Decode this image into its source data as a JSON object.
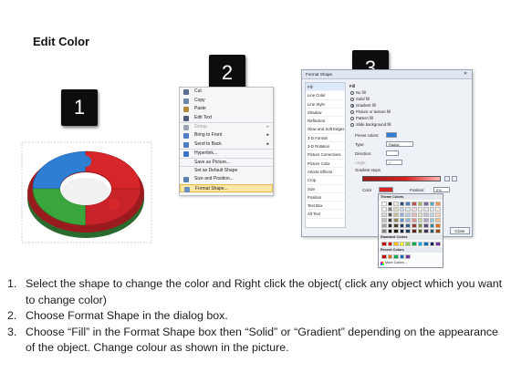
{
  "title": "Edit Color",
  "steps": [
    {
      "number": "1",
      "text": "Select the shape to change the color and Right click the object( click any object which you want to change color)"
    },
    {
      "number": "2",
      "text": "Choose Format Shape in the dialog box."
    },
    {
      "number": "3",
      "text": "Choose “Fill” in the Format Shape box then “Solid” or “Gradient” depending on the appearance of the object. Change colour as shown in the picture."
    }
  ],
  "context_menu": {
    "items": [
      {
        "label": "Cut",
        "icon": "scissors-icon",
        "icon_color": "#5a6f91"
      },
      {
        "label": "Copy",
        "icon": "copy-icon",
        "icon_color": "#6d86a8"
      },
      {
        "label": "Paste",
        "icon": "paste-icon",
        "icon_color": "#b48a3a"
      },
      {
        "label": "Edit Text",
        "icon": "text-icon",
        "icon_color": "#4d5d7a"
      },
      {
        "label": "Group",
        "icon": "group-icon",
        "icon_color": "#9aa4b1",
        "disabled": true,
        "submenu": true
      },
      {
        "label": "Bring to Front",
        "icon": "bring-front-icon",
        "icon_color": "#4e7cc2",
        "submenu": true
      },
      {
        "label": "Send to Back",
        "icon": "send-back-icon",
        "icon_color": "#4e7cc2",
        "submenu": true
      },
      {
        "label": "Hyperlink...",
        "icon": "hyperlink-icon",
        "icon_color": "#3c73c4"
      },
      {
        "label": "Save as Picture...",
        "icon": "",
        "icon_color": ""
      },
      {
        "label": "Set as Default Shape",
        "icon": "",
        "icon_color": ""
      },
      {
        "label": "Size and Position...",
        "icon": "size-icon",
        "icon_color": "#5a7fb0"
      },
      {
        "label": "Format Shape...",
        "icon": "format-shape-icon",
        "icon_color": "#6c8fc1",
        "highlighted": true
      }
    ]
  },
  "format_dialog": {
    "title": "Format Shape",
    "nav": [
      "Fill",
      "Line Color",
      "Line Style",
      "Shadow",
      "Reflection",
      "Glow and Soft Edges",
      "3-D Format",
      "3-D Rotation",
      "Picture Corrections",
      "Picture Color",
      "Artistic Effects",
      "Crop",
      "Size",
      "Position",
      "Text Box",
      "Alt Text"
    ],
    "selected_nav": "Fill",
    "section": "Fill",
    "fill_options": [
      {
        "label": "No fill",
        "checked": false
      },
      {
        "label": "Solid fill",
        "checked": false
      },
      {
        "label": "Gradient fill",
        "checked": true
      },
      {
        "label": "Picture or texture fill",
        "checked": false
      },
      {
        "label": "Pattern fill",
        "checked": false
      },
      {
        "label": "Slide background fill",
        "checked": false
      }
    ],
    "preset_colors_label": "Preset colors:",
    "type_label": "Type:",
    "type_value": "Radial",
    "direction_label": "Direction:",
    "angle_label": "Angle:",
    "angle_value": "0°",
    "gradient_stops_label": "Gradient stops",
    "color_label": "Color",
    "position_label": "Position:",
    "position_value": "0%",
    "brightness_label": "Brightness:",
    "transparency_label": "Transparency:",
    "rotate_label": "Rotate with shape",
    "close_label": "Close"
  },
  "color_palette": {
    "theme_heading": "Theme Colors",
    "standard_heading": "Standard Colors",
    "recent_heading": "Recent Colors",
    "more_label": "More Colors...",
    "theme_colors": [
      "#ffffff",
      "#000000",
      "#eeece1",
      "#1f497d",
      "#4f81bd",
      "#c0504d",
      "#9bbb59",
      "#8064a2",
      "#4bacc6",
      "#f79646",
      "#f2f2f2",
      "#7f7f7f",
      "#ddd9c3",
      "#c6d9f0",
      "#dbe5f1",
      "#f2dcdb",
      "#ebf1dd",
      "#e5e0ec",
      "#dbeef3",
      "#fdeada",
      "#d8d8d8",
      "#595959",
      "#c4bd97",
      "#8db3e2",
      "#b8cce4",
      "#e5b9b7",
      "#d7e3bc",
      "#ccc1d9",
      "#b7dde8",
      "#fbd5b5",
      "#bfbfbf",
      "#3f3f3f",
      "#938953",
      "#548dd4",
      "#95b3d7",
      "#d99694",
      "#c3d69b",
      "#b2a2c7",
      "#92cddc",
      "#fac08f",
      "#a5a5a5",
      "#262626",
      "#494429",
      "#17365d",
      "#366092",
      "#953734",
      "#76923c",
      "#5f497a",
      "#31859b",
      "#e36c09",
      "#7f7f7f",
      "#0c0c0c",
      "#1d1b10",
      "#0f243e",
      "#244061",
      "#632423",
      "#4f6128",
      "#3f3151",
      "#205867",
      "#974806"
    ],
    "standard_colors": [
      "#c00000",
      "#ff0000",
      "#ffc000",
      "#ffff00",
      "#92d050",
      "#00b050",
      "#00b0f0",
      "#0070c0",
      "#002060",
      "#7030a0"
    ],
    "recent_colors": [
      "#c00000",
      "#e36c09",
      "#00b050",
      "#0070c0",
      "#7030a0"
    ]
  },
  "ring_colors": {
    "blue": "#2e7fd3",
    "red": "#d7262a",
    "green": "#3aa53c"
  },
  "dialog_accent": "#2a5fb0"
}
